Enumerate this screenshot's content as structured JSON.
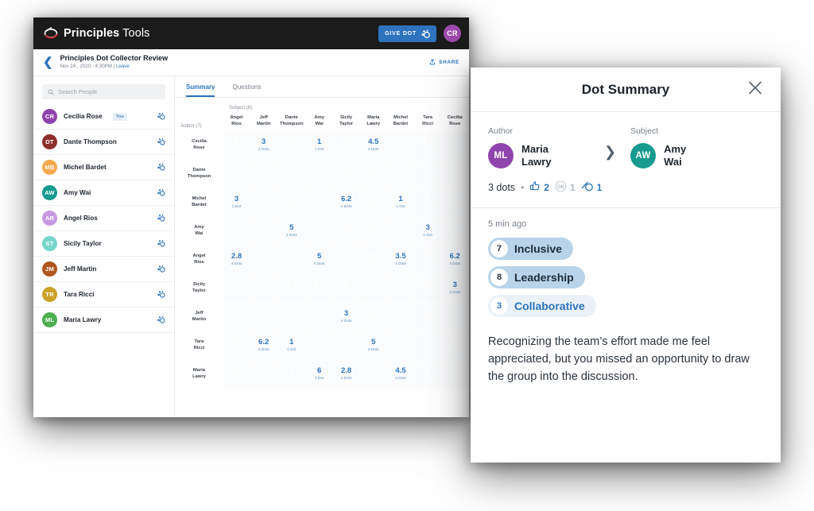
{
  "app": {
    "brand_bold": "Principles",
    "brand_light": " Tools",
    "brand_logo_icon": "principles-logo-icon",
    "give_dot_label": "GIVE DOT",
    "give_dot_icon": "dot-icon",
    "user_avatar_initials": "CR",
    "user_avatar_color": "#9b4bab"
  },
  "breadcrumb": {
    "back_icon": "chevron-left-icon",
    "title": "Principles Dot Collector Review",
    "subtitle_date": "Nov 24 , 2020 - 4:30PM",
    "subtitle_separator": "|",
    "leave_label": "Leave",
    "share_label": "SHARE",
    "share_icon": "share-icon"
  },
  "sidebar": {
    "search": {
      "placeholder": "Search People",
      "value": "",
      "icon": "search-icon"
    },
    "people": [
      {
        "initials": "CR",
        "name": "Cecilia Rose",
        "color": "#8e44ad",
        "badge": "You"
      },
      {
        "initials": "DT",
        "name": "Dante Thompson",
        "color": "#8e2f2b",
        "badge": ""
      },
      {
        "initials": "MB",
        "name": "Michel Bardet",
        "color": "#f5a councils",
        "badge": ""
      },
      {
        "initials": "AW",
        "name": "Amy Wai",
        "color": "#179a90",
        "badge": ""
      },
      {
        "initials": "AR",
        "name": "Angel Rios",
        "color": "#c79ae0",
        "badge": ""
      },
      {
        "initials": "ST",
        "name": "Sicily Taylor",
        "color": "#76d6cb",
        "badge": ""
      },
      {
        "initials": "JM",
        "name": "Jeff Martin",
        "color": "#b0571f",
        "badge": ""
      },
      {
        "initials": "TR",
        "name": "Tara Ricci",
        "color": "#c9a227",
        "badge": ""
      },
      {
        "initials": "ML",
        "name": "Maria Lawry",
        "color": "#4caf50",
        "badge": ""
      }
    ],
    "row_dot_icon": "dot-icon"
  },
  "main": {
    "tabs": [
      {
        "label": "Summary",
        "active": true
      },
      {
        "label": "Questions",
        "active": false
      }
    ],
    "subject_axis_label": "Subject (8)",
    "author_axis_label": "Author (7)"
  },
  "chart_data": {
    "type": "heatmap",
    "title": "Principles Dot Collector Review",
    "xlabel": "Subject (8)",
    "ylabel": "Author (7)",
    "columns": [
      "Angel Rios",
      "Jeff Martin",
      "Dante Thompson",
      "Amy Wai",
      "Sicily Taylor",
      "Maria Lawry",
      "Michel Bardet",
      "Tara Ricci",
      "Cecilia Rose"
    ],
    "rows": [
      "Cecilia Rose",
      "Dante Thompson",
      "Michel Bardet",
      "Amy Wai",
      "Angel Rios",
      "Sicily Taylor",
      "Jeff Martin",
      "Tara Ricci",
      "Maria Lawry"
    ],
    "cell_value_key": "score",
    "cell_sub_key": "dots",
    "values": [
      [
        {
          "score": "9",
          "dots": "3 Dots",
          "tone": "dark"
        },
        {
          "score": "3",
          "dots": "4 Dots",
          "tone": "light"
        },
        {
          "score": "7.5",
          "dots": "1 Dot",
          "tone": "dark"
        },
        {
          "score": "1",
          "dots": "1 Dot",
          "tone": "light"
        },
        {
          "score": "9.3",
          "dots": "4 Dots",
          "tone": "dark"
        },
        {
          "score": "4.5",
          "dots": "4 Dots",
          "tone": "light"
        },
        {
          "score": "9",
          "dots": "3 Dots",
          "tone": "dark"
        },
        {
          "score": "8.2",
          "dots": "6 Dots",
          "tone": "dark"
        },
        {
          "score": "",
          "dots": "",
          "tone": "empty"
        }
      ],
      [
        {
          "score": "",
          "dots": "",
          "tone": "empty"
        },
        {
          "score": "7",
          "dots": "3 Dots",
          "tone": "dark"
        },
        {
          "score": "",
          "dots": "",
          "tone": "empty"
        },
        {
          "score": "8",
          "dots": "6 Dots",
          "tone": "dark"
        },
        {
          "score": "8.5",
          "dots": "6 Dots",
          "tone": "dark"
        },
        {
          "score": "8",
          "dots": "3 Dots",
          "tone": "dark"
        },
        {
          "score": "",
          "dots": "",
          "tone": "empty"
        },
        {
          "score": "7",
          "dots": "6 Dots",
          "tone": "dark"
        },
        {
          "score": "9.3",
          "dots": "4 Dots",
          "tone": "dark"
        }
      ],
      [
        {
          "score": "3",
          "dots": "1 Dot",
          "tone": "light"
        },
        {
          "score": "8",
          "dots": "5 Dots",
          "tone": "dark"
        },
        {
          "score": "9",
          "dots": "3 Dots",
          "tone": "dark"
        },
        {
          "score": "7",
          "dots": "4 Dots",
          "tone": "dark"
        },
        {
          "score": "6.2",
          "dots": "4 Dots",
          "tone": "mid"
        },
        {
          "score": "7.8",
          "dots": "5 Dots",
          "tone": "dark"
        },
        {
          "score": "1",
          "dots": "1 Dot",
          "tone": "light"
        },
        {
          "score": "8",
          "dots": "6 Dots",
          "tone": "dark"
        },
        {
          "score": "7",
          "dots": "3 Dots",
          "tone": "dark"
        }
      ],
      [
        {
          "score": "7",
          "dots": "3 Dots",
          "tone": "dark"
        },
        {
          "score": "8",
          "dots": "3 Dots",
          "tone": "dark"
        },
        {
          "score": "5",
          "dots": "2 Dots",
          "tone": "mid"
        },
        {
          "score": "",
          "dots": "",
          "tone": "empty"
        },
        {
          "score": "8.2",
          "dots": "6 Dots",
          "tone": "dark"
        },
        {
          "score": "7.5",
          "dots": "3 Dots",
          "tone": "dark"
        },
        {
          "score": "8",
          "dots": "3 Dots",
          "tone": "dark"
        },
        {
          "score": "3",
          "dots": "1 Dot",
          "tone": "light"
        },
        {
          "score": "7",
          "dots": "4 Dots",
          "tone": "dark"
        }
      ],
      [
        {
          "score": "2.8",
          "dots": "4 Dots",
          "tone": "light"
        },
        {
          "score": "9.5",
          "dots": "4 Dots",
          "tone": "dark"
        },
        {
          "score": "7",
          "dots": "3 Dots",
          "tone": "dark"
        },
        {
          "score": "5",
          "dots": "4 Dots",
          "tone": "light"
        },
        {
          "score": "8",
          "dots": "1 Dot",
          "tone": "dark"
        },
        {
          "score": "8.5",
          "dots": "4 Dots",
          "tone": "dark"
        },
        {
          "score": "3.5",
          "dots": "2 Dots",
          "tone": "light"
        },
        {
          "score": "7.5",
          "dots": "1 Dot",
          "tone": "dark"
        },
        {
          "score": "6.2",
          "dots": "4 Dots",
          "tone": "mid"
        }
      ],
      [
        {
          "score": "7",
          "dots": "6 Dots",
          "tone": "dark"
        },
        {
          "score": "",
          "dots": "",
          "tone": "empty"
        },
        {
          "score": "7.3",
          "dots": "2 Dots",
          "tone": "dark"
        },
        {
          "score": "8.2",
          "dots": "6 Dots",
          "tone": "dark"
        },
        {
          "score": "9",
          "dots": "6 Dots",
          "tone": "dark"
        },
        {
          "score": "",
          "dots": "",
          "tone": "empty"
        },
        {
          "score": "8",
          "dots": "6 Dots",
          "tone": "dark"
        },
        {
          "score": "9.5",
          "dots": "4 Dots",
          "tone": "dark"
        },
        {
          "score": "3",
          "dots": "4 Dots",
          "tone": "light"
        }
      ],
      [
        {
          "score": "8",
          "dots": "1 Dot",
          "tone": "dark"
        },
        {
          "score": "9.3",
          "dots": "4 Dots",
          "tone": "dark"
        },
        {
          "score": "",
          "dots": "",
          "tone": "empty"
        },
        {
          "score": "",
          "dots": "",
          "tone": "empty"
        },
        {
          "score": "3",
          "dots": "4 Dots",
          "tone": "light"
        },
        {
          "score": "9.5",
          "dots": "4 Dots",
          "tone": "dark"
        },
        {
          "score": "8.5",
          "dots": "6 Dots",
          "tone": "dark"
        },
        {
          "score": "9.3",
          "dots": "4 Dots",
          "tone": "dark"
        },
        {
          "score": "",
          "dots": "",
          "tone": "empty"
        }
      ],
      [
        {
          "score": "7.5",
          "dots": "1 Dot",
          "tone": "dark"
        },
        {
          "score": "6.2",
          "dots": "4 Dots",
          "tone": "mid"
        },
        {
          "score": "1",
          "dots": "1 Dot",
          "tone": "light"
        },
        {
          "score": "8",
          "dots": "6 Dots",
          "tone": "dark"
        },
        {
          "score": "7",
          "dots": "3 Dots",
          "tone": "dark"
        },
        {
          "score": "5",
          "dots": "2 Dots",
          "tone": "mid"
        },
        {
          "score": "7",
          "dots": "6 Dots",
          "tone": "dark"
        },
        {
          "score": "",
          "dots": "",
          "tone": "empty"
        },
        {
          "score": "7.8",
          "dots": "5 Dots",
          "tone": "dark"
        }
      ],
      [
        {
          "score": "9",
          "dots": "6 Dots",
          "tone": "dark"
        },
        {
          "score": "7",
          "dots": "6 Dots",
          "tone": "dark"
        },
        {
          "score": "8",
          "dots": "5 Dots",
          "tone": "dark"
        },
        {
          "score": "6",
          "dots": "3 Dot",
          "tone": "mid"
        },
        {
          "score": "2.8",
          "dots": "4 Dots",
          "tone": "light"
        },
        {
          "score": "",
          "dots": "",
          "tone": "empty"
        },
        {
          "score": "4.5",
          "dots": "4 Dots",
          "tone": "light"
        },
        {
          "score": "8",
          "dots": "3 Dots",
          "tone": "dark"
        },
        {
          "score": "9.5",
          "dots": "4 Dots",
          "tone": "dark"
        }
      ]
    ],
    "legend": {
      "high_color": "#14355e",
      "mid_color": "#c9ddf0",
      "low_color": "#dfebf7"
    }
  },
  "dot_summary": {
    "title": "Dot Summary",
    "close_icon": "close-icon",
    "author_label": "Author",
    "subject_label": "Subject",
    "arrow_icon": "chevron-right-icon",
    "author": {
      "initials": "ML",
      "name_line1": "Maria",
      "name_line2": "Lawry",
      "color": "#8e44ad"
    },
    "subject": {
      "initials": "AW",
      "name_line1": "Amy",
      "name_line2": "Wai",
      "color": "#179a90"
    },
    "dots_count_text": "3 dots",
    "bullet": "•",
    "thumbs_up_icon": "thumbs-up-icon",
    "thumbs_up_count": "2",
    "ok_icon": "ok-circle-icon",
    "ok_count": "1",
    "dot_icon": "dot-icon",
    "dot_count": "1",
    "time_ago": "5 min ago",
    "attributes": [
      {
        "score": "7",
        "label": "Inclusive",
        "tone": "strong"
      },
      {
        "score": "8",
        "label": "Leadership",
        "tone": "strong"
      },
      {
        "score": "3",
        "label": "Collaborative",
        "tone": "soft"
      }
    ],
    "comment": "Recognizing the team’s effort made me feel appreciated, but you missed an opportunity to draw the group into the discussion."
  }
}
